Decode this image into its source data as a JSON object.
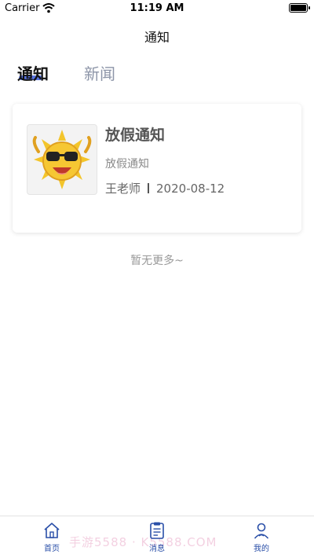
{
  "status_bar": {
    "carrier": "Carrier",
    "time": "11:19 AM"
  },
  "nav": {
    "title": "通知"
  },
  "tabs": [
    {
      "label": "通知",
      "active": true
    },
    {
      "label": "新闻",
      "active": false
    }
  ],
  "notice": {
    "title": "放假通知",
    "summary": "放假通知",
    "author": "王老师",
    "date": "2020-08-12",
    "thumbnail_icon": "sun-sunglasses-icon"
  },
  "list_footer": "暂无更多~",
  "tabbar": [
    {
      "label": "首页",
      "icon": "home-icon"
    },
    {
      "label": "消息",
      "icon": "clipboard-icon"
    },
    {
      "label": "我的",
      "icon": "user-icon"
    }
  ],
  "watermark": "手游5588 · K5588.COM",
  "colors": {
    "accent": "#3b5bd8",
    "tab_inactive": "#8d95a8",
    "tabbar_label": "#2a4fa8"
  }
}
